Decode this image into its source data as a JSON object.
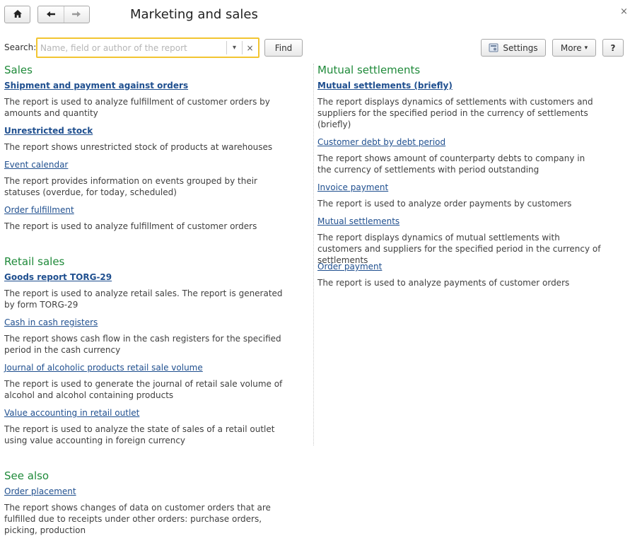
{
  "window": {
    "title": "Marketing and sales",
    "home_icon": "home-icon",
    "back_icon": "arrow-left-icon",
    "forward_icon": "arrow-right-icon",
    "close_glyph": "×"
  },
  "search": {
    "label": "Search:",
    "placeholder": "Name, field or author of the report",
    "value": "",
    "dropdown_glyph": "▾",
    "clear_glyph": "×",
    "find_label": "Find"
  },
  "toolbar": {
    "settings_label": "Settings",
    "more_label": "More",
    "more_arrow": "▾",
    "help_label": "?"
  },
  "sections": {
    "sales": {
      "title": "Sales",
      "items": [
        {
          "label": "Shipment and payment against orders",
          "desc": "The report is used to analyze fulfillment of customer orders by amounts and quantity"
        },
        {
          "label": "Unrestricted stock",
          "desc": "The report shows unrestricted stock of products at warehouses"
        },
        {
          "label": "Event calendar",
          "desc": "The report provides information on events grouped by their statuses (overdue, for today, scheduled)"
        },
        {
          "label": "Order fulfillment",
          "desc": "The report is used to analyze fulfillment of customer orders"
        }
      ]
    },
    "retail": {
      "title": "Retail sales",
      "items": [
        {
          "label": "Goods report TORG-29",
          "desc": "The report is used to analyze retail sales. The report is generated by form TORG-29"
        },
        {
          "label": "Cash in cash registers",
          "desc": "The report shows cash flow in the cash registers for the specified period in the cash currency"
        },
        {
          "label": "Journal of alcoholic products retail sale volume",
          "desc": "The report is used to generate the journal of retail sale volume of alcohol and alcohol containing products"
        },
        {
          "label": "Value accounting in retail outlet",
          "desc": "The report is used to analyze the state of sales of a retail outlet using value accounting in foreign currency"
        }
      ]
    },
    "see_also": {
      "title": "See also",
      "items": [
        {
          "label": "Order placement",
          "desc": "The report shows changes of data on customer orders that are fulfilled due to receipts under other orders: purchase orders, picking, production"
        }
      ]
    },
    "mutual": {
      "title": "Mutual settlements",
      "items": [
        {
          "label": "Mutual settlements (briefly)",
          "desc": "The report displays dynamics of settlements with customers and suppliers for the specified period in the currency of settlements (briefly)"
        },
        {
          "label": "Customer debt by debt period",
          "desc": "The report shows amount of counterparty debts to company in the currency of settlements with period outstanding"
        },
        {
          "label": "Invoice payment",
          "desc": "The report is used to analyze order payments by customers"
        },
        {
          "label": "Mutual settlements",
          "desc": "The report displays dynamics of mutual settlements with customers and suppliers for the specified period in the currency of settlements"
        },
        {
          "label": "Order payment",
          "desc": "The report is used to analyze payments of customer orders"
        }
      ]
    }
  }
}
